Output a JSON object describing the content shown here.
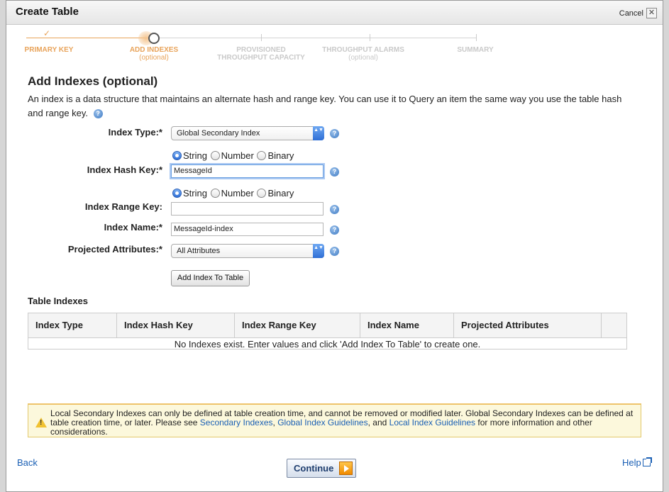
{
  "dialog": {
    "title": "Create Table",
    "cancel_label": "Cancel",
    "close_glyph": "✕"
  },
  "wizard": {
    "steps": [
      {
        "label": "PRIMARY KEY",
        "sub": "",
        "state": "done"
      },
      {
        "label": "ADD INDEXES",
        "sub": "(optional)",
        "state": "current"
      },
      {
        "label": "PROVISIONED",
        "sub": "THROUGHPUT CAPACITY",
        "state": "todo"
      },
      {
        "label": "THROUGHPUT ALARMS",
        "sub": "(optional)",
        "state": "todo"
      },
      {
        "label": "SUMMARY",
        "sub": "",
        "state": "todo"
      }
    ],
    "done_check": "✓"
  },
  "section": {
    "heading": "Add Indexes (optional)",
    "description": "An index is a data structure that maintains an alternate hash and range key. You can use it to Query an item the same way you use the table hash and range key."
  },
  "help_glyph": "?",
  "form": {
    "index_type": {
      "label": "Index Type:*",
      "value": "Global Secondary Index"
    },
    "hash_key_type": {
      "options": [
        "String",
        "Number",
        "Binary"
      ],
      "selected": "String"
    },
    "hash_key": {
      "label": "Index Hash Key:*",
      "value": "MessageId"
    },
    "range_key_type": {
      "options": [
        "String",
        "Number",
        "Binary"
      ],
      "selected": "String"
    },
    "range_key": {
      "label": "Index Range Key:",
      "value": ""
    },
    "index_name": {
      "label": "Index Name:*",
      "value": "MessageId-index"
    },
    "projected": {
      "label": "Projected Attributes:*",
      "value": "All Attributes"
    },
    "add_button": "Add Index To Table",
    "select_arrow": "▲▼"
  },
  "table": {
    "title": "Table Indexes",
    "columns": [
      "Index Type",
      "Index Hash Key",
      "Index Range Key",
      "Index Name",
      "Projected Attributes"
    ],
    "empty_message": "No Indexes exist. Enter values and click 'Add Index To Table' to create one."
  },
  "warning": {
    "text_1": "Local Secondary Indexes can only be defined at table creation time, and cannot be removed or modified later. Global Secondary Indexes can be defined at table creation time, or later. Please see ",
    "link_1": "Secondary Indexes",
    "sep_1": ", ",
    "link_2": "Global Index Guidelines",
    "sep_2": ", and ",
    "link_3": "Local Index Guidelines",
    "text_2": " for more information and other considerations."
  },
  "footer": {
    "back": "Back",
    "continue": "Continue",
    "help": "Help"
  }
}
